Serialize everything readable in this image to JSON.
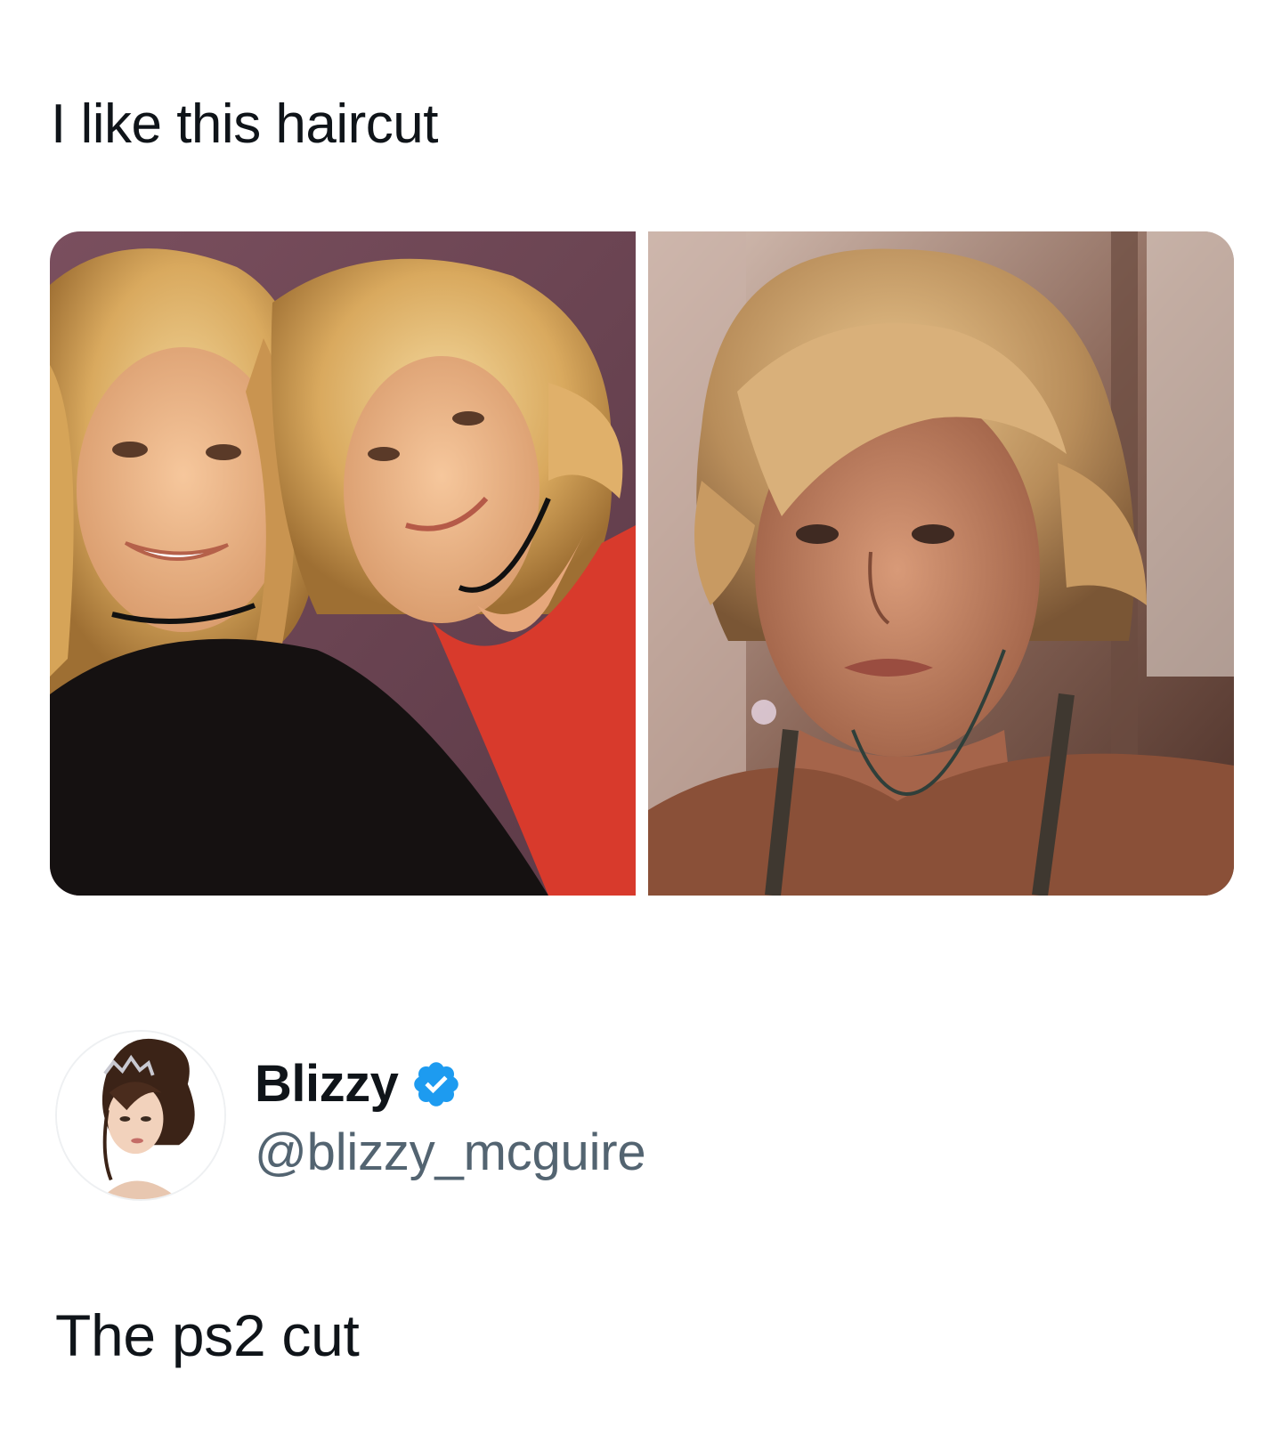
{
  "quoted_post": {
    "text": "I like this haircut",
    "media": [
      {
        "icon": "photo-two-blonde-girls-icon"
      },
      {
        "icon": "photo-woman-short-hair-icon"
      }
    ]
  },
  "author": {
    "display_name": "Blizzy",
    "handle": "@blizzy_mcguire",
    "verified": true,
    "verified_icon": "verified-badge-icon",
    "avatar_icon": "avatar-icon"
  },
  "reply": {
    "text": "The ps2 cut"
  },
  "colors": {
    "text_primary": "#0f1419",
    "text_secondary": "#536471",
    "verified_blue": "#1d9bf0",
    "background": "#ffffff"
  }
}
